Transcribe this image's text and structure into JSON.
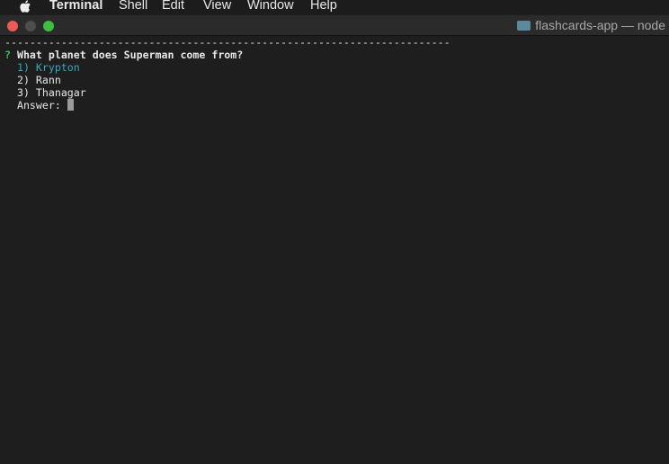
{
  "menubar": {
    "app": "Terminal",
    "items": [
      "Shell",
      "Edit",
      "View",
      "Window",
      "Help"
    ]
  },
  "window": {
    "title": "flashcards-app — node"
  },
  "terminal": {
    "separator": "-----------------------------------------------------------------------",
    "prompt_mark": "?",
    "question": "What planet does Superman come from?",
    "options": [
      "1) Krypton",
      "2) Rann",
      "3) Thanagar"
    ],
    "answer_label": "Answer: "
  },
  "colors": {
    "accent": "#3ba7b8",
    "prompt": "#3fbf4f"
  }
}
